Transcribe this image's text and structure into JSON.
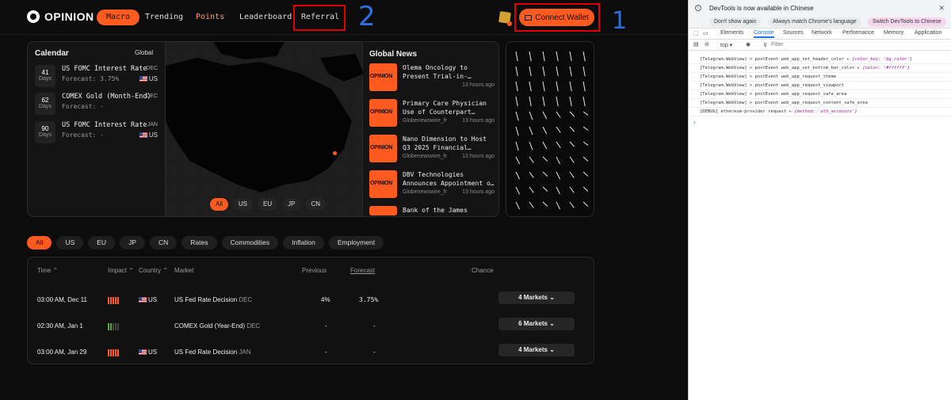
{
  "header": {
    "brand": "OPINION",
    "nav": [
      {
        "label": "Macro",
        "active": true
      },
      {
        "label": "Trending"
      },
      {
        "label": "Points"
      },
      {
        "label": "Leaderboard"
      },
      {
        "label": "Referral"
      }
    ],
    "connect_wallet": "Connect Wallet"
  },
  "annotations": {
    "referral_mark": "2",
    "wallet_mark": "1",
    "color": "#e00000"
  },
  "calendar": {
    "title": "Calendar",
    "scope": "Global",
    "events": [
      {
        "days": "41",
        "days_label": "Days",
        "title": "US FOMC Interest Rate",
        "month": "DEC",
        "forecast": "Forecast: 3.75%",
        "country": "US"
      },
      {
        "days": "62",
        "days_label": "Days",
        "title": "COMEX Gold (Month-End)",
        "month": "DEC",
        "forecast": "Forecast: -",
        "country": ""
      },
      {
        "days": "90",
        "days_label": "Days",
        "title": "US FOMC Interest Rate",
        "month": "JAN",
        "forecast": "Forecast: -",
        "country": "US"
      }
    ]
  },
  "map": {
    "chips": [
      "All",
      "US",
      "EU",
      "JP",
      "CN"
    ],
    "active_chip": "All"
  },
  "news": {
    "title": "Global News",
    "thumb_label": "OPINION",
    "items": [
      {
        "title": "Olema Oncology to Present Trial-in-…",
        "source": "",
        "time": "13 hours ago"
      },
      {
        "title": "Primary Care Physician Use of Counterpart…",
        "source": "Globenewswire_fr",
        "time": "13 hours ago"
      },
      {
        "title": "Nano Dimension to Host Q3 2025 Financial…",
        "source": "Globenewswire_fr",
        "time": "13 hours ago"
      },
      {
        "title": "DBV Technologies Announces Appointment o…",
        "source": "Globenewswire_fr",
        "time": "13 hours ago"
      },
      {
        "title": "Bank of the James",
        "source": "",
        "time": ""
      }
    ]
  },
  "filters": {
    "items": [
      "All",
      "US",
      "EU",
      "JP",
      "CN",
      "Rates",
      "Commodities",
      "Inflation",
      "Employment"
    ],
    "active": "All"
  },
  "table": {
    "headers": {
      "time": "Time ⌃",
      "impact": "Impact ⌃",
      "country": "Country ⌃",
      "market": "Market",
      "previous": "Previous",
      "forecast": "Forecast",
      "chance": "Chance"
    },
    "rows": [
      {
        "time": "03:00 AM, Dec 11",
        "impact": "high",
        "country": "US",
        "market": "US Fed Rate Decision",
        "month": "DEC",
        "previous": "4%",
        "forecast": "3.75%",
        "markets": "4 Markets ⌄"
      },
      {
        "time": "02:30 AM, Jan 1",
        "impact": "low",
        "country": "",
        "market": "COMEX Gold (Year-End)",
        "month": "DEC",
        "previous": "-",
        "forecast": "-",
        "markets": "6 Markets ⌄"
      },
      {
        "time": "03:00 AM, Jan 29",
        "impact": "high",
        "country": "US",
        "market": "US Fed Rate Decision",
        "month": "JAN",
        "previous": "-",
        "forecast": "-",
        "markets": "4 Markets ⌄"
      }
    ]
  },
  "devtools": {
    "info": "DevTools is now available in Chinese",
    "buttons": [
      "Don't show again",
      "Always match Chrome's language",
      "Switch DevTools to Chinese"
    ],
    "tabs": [
      "Elements",
      "Console",
      "Sources",
      "Network",
      "Performance",
      "Memory",
      "Application"
    ],
    "active_tab": "Console",
    "context": "top ▾",
    "filter_placeholder": "Filter",
    "logs": [
      {
        "text": "[Telegram.WebView] > postEvent web_app_set_header_color ",
        "obj": "▸ {color_key: 'bg_color'}"
      },
      {
        "text": "[Telegram.WebView] > postEvent web_app_set_bottom_bar_color ",
        "obj": "▸ {color: '#ffffff'}"
      },
      {
        "text": "[Telegram.WebView] > postEvent web_app_request_theme",
        "obj": ""
      },
      {
        "text": "[Telegram.WebView] > postEvent web_app_request_viewport",
        "obj": ""
      },
      {
        "text": "[Telegram.WebView] > postEvent web_app_request_safe_area",
        "obj": ""
      },
      {
        "text": "[Telegram.WebView] > postEvent web_app_request_content_safe_area",
        "obj": ""
      },
      {
        "text": "[DEBUG] ethereum-provider request ",
        "obj": "▸ {method: 'eth_accounts'}"
      }
    ],
    "prompt": "›"
  }
}
